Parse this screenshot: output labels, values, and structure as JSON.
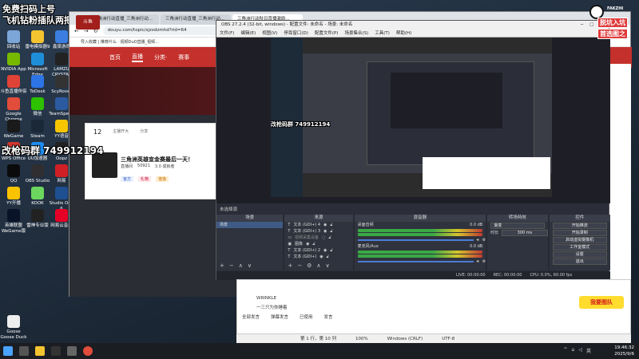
{
  "overlay": {
    "top_left_line1": "免费扫码上号",
    "top_left_line2": "飞机钻粉插队两把",
    "group_text": "改枪码群 749912194",
    "obs_group_text": "改枪码群 749912194",
    "corner_logo_line1": "脱坑入坑",
    "corner_logo_line2": "首选图之",
    "corner_logo_small": "FAKZHI"
  },
  "desktop_icons": [
    {
      "label": "回收站",
      "color": "#7da6d8"
    },
    {
      "label": "雷电模拟器9",
      "color": "#f4c430"
    },
    {
      "label": "鑫梁游戏",
      "color": "#3b7de0"
    },
    {
      "label": "NVIDIA App",
      "color": "#76b900"
    },
    {
      "label": "Microsoft Edge",
      "color": "#1f8ed8"
    },
    {
      "label": "LAMZU CRYSTAL",
      "color": "#222"
    },
    {
      "label": "斗鱼直播伴侣",
      "color": "#e04336"
    },
    {
      "label": "ToDesk",
      "color": "#2d74e6"
    },
    {
      "label": "ScyRover",
      "color": "#333"
    },
    {
      "label": "Google Chrome",
      "color": "#e14c3b"
    },
    {
      "label": "微信",
      "color": "#2dc100"
    },
    {
      "label": "TeamSpeak",
      "color": "#2c5aa0"
    },
    {
      "label": "WeGame",
      "color": "#1a1a1a"
    },
    {
      "label": "Steam",
      "color": "#1b2838"
    },
    {
      "label": "YY语音",
      "color": "#f7c600"
    },
    {
      "label": "WPS Office",
      "color": "#d3372f"
    },
    {
      "label": "UU加速器",
      "color": "#1e8cf0"
    },
    {
      "label": "Oopz",
      "color": "#222"
    },
    {
      "label": "QQ",
      "color": "#0b0b0b"
    },
    {
      "label": "OBS Studio",
      "color": "#302e31"
    },
    {
      "label": "网易",
      "color": "#d01f25"
    },
    {
      "label": "YY开播",
      "color": "#f9c300"
    },
    {
      "label": "KOOK",
      "color": "#6cd65f"
    },
    {
      "label": "Studio One 6",
      "color": "#1d4f91"
    },
    {
      "label": "英雄联盟WeGame版",
      "color": "#0a1428"
    },
    {
      "label": "雷神专业版",
      "color": "#222"
    },
    {
      "label": "网易云音乐",
      "color": "#e60026"
    },
    {
      "label": "Goose Goose Duck",
      "color": "#eee"
    }
  ],
  "browser": {
    "tabs": [
      "三角洲行动直播_三角洲行动...",
      "三角洲行动直播_三角洲行动...",
      "三角洲行动秋日直播激励..."
    ],
    "url": "douyu.com/topic/sjzxdzmhd?rid=64",
    "bookmarks": "导入收藏  |  推荐什么 · 视频DuO直播_视频...",
    "nav_items": [
      "首页",
      "直播",
      "分类·",
      "赛事"
    ],
    "logo": "斗鱼",
    "card_stats": [
      "12",
      "主播开大",
      "分享"
    ],
    "card_title": "三角洲英雄宣金赛最后一天！",
    "card_meta": [
      "直播间",
      "50921",
      "3.0 成就者"
    ],
    "card_badges": [
      "官方",
      "礼物",
      "猫猫"
    ]
  },
  "obs": {
    "title": "OBS 27.2.4 (32-bit, windows) - 配置文件: 未命名 - 场景: 未命名",
    "menu": [
      "文件(F)",
      "编辑(E)",
      "视图(V)",
      "停靠窗口(D)",
      "配置文件(P)",
      "场景集合(S)",
      "工具(T)",
      "帮助(H)"
    ],
    "no_source": "未选择源",
    "docks": {
      "scenes": {
        "header": "场景",
        "items": [
          "场景"
        ]
      },
      "sources": {
        "header": "来源",
        "items": [
          "文本 (GDI+) 4",
          "文本 (GDI+) 3",
          "视频采集设备",
          "图像",
          "文本 (GDI+) 2",
          "文本 (GDI+)"
        ]
      },
      "mixer": {
        "header": "混音器",
        "channels": [
          {
            "name": "桌面音频",
            "db": "0.0 dB"
          },
          {
            "name": "麦克风/Aux",
            "db": "0.0 dB"
          }
        ]
      },
      "transitions": {
        "header": "转场特效",
        "type": "渐变",
        "duration_label": "时长",
        "duration": "300 ms"
      },
      "controls": {
        "header": "控件",
        "buttons": [
          "开始推流",
          "开始录制",
          "启动虚拟摄像机",
          "工作室模式",
          "设置",
          "退出"
        ]
      }
    },
    "status": [
      "LIVE: 00:00:00",
      "REC: 00:00:00",
      "CPU: 0.0%, 60.00 fps"
    ]
  },
  "chatapp": {
    "send_label": "我要图队",
    "toolbar": [
      "全部发言",
      "弹幕发言",
      "已使用",
      "发言"
    ],
    "entries": [
      "WRINKLE",
      "一三只为你睡着"
    ]
  },
  "notepad_status": [
    "第 1 行，第 10 列",
    "100%",
    "Windows (CRLF)",
    "UTF-8"
  ],
  "taskbar": {
    "time": "19:46:32",
    "date": "2025/9/6",
    "lang": "英"
  }
}
